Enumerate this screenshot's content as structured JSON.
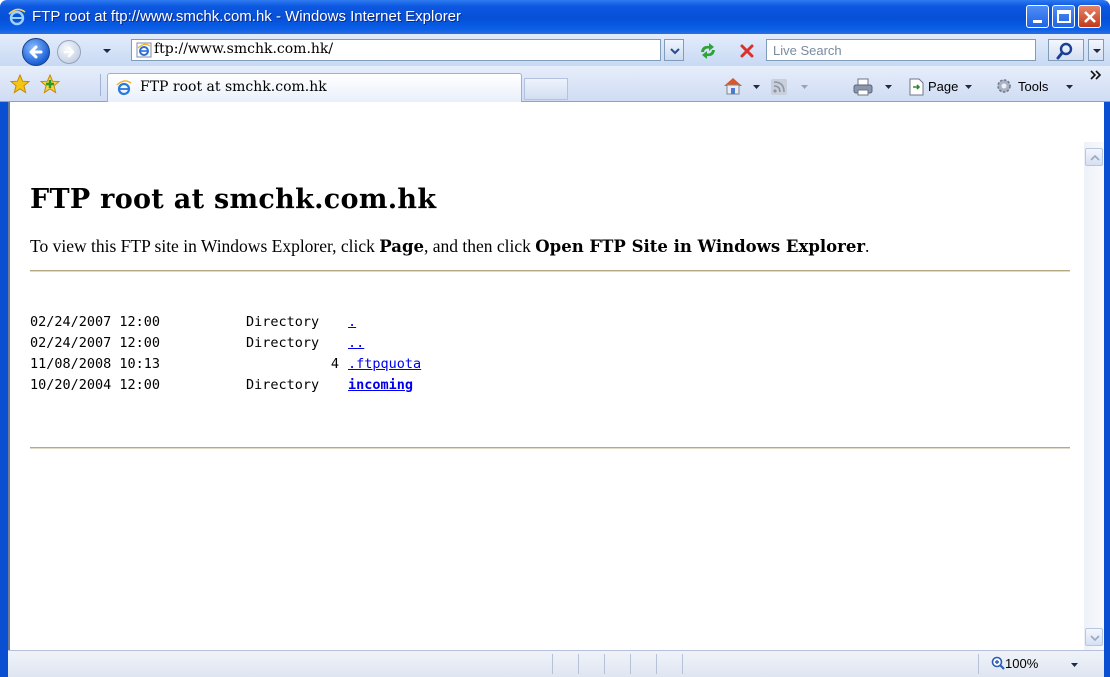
{
  "window": {
    "title": "FTP root at ftp://www.smchk.com.hk - Windows Internet Explorer"
  },
  "toolbar": {
    "address": "ftp://www.smchk.com.hk/",
    "search_placeholder": "Live Search"
  },
  "tabs": [
    {
      "label": "FTP root at smchk.com.hk",
      "icon": "ie-page-icon"
    }
  ],
  "command_bar": {
    "page_label": "Page",
    "tools_label": "Tools"
  },
  "page": {
    "heading": "FTP root at smchk.com.hk",
    "instruction_prefix": "To view this FTP site in Windows Explorer, click ",
    "instruction_page": "Page",
    "instruction_middle": ", and then click ",
    "instruction_open": "Open FTP Site in Windows Explorer",
    "instruction_suffix": "."
  },
  "listing": [
    {
      "date": "02/24/2007 12:00",
      "type": "Directory",
      "name": "."
    },
    {
      "date": "02/24/2007 12:00",
      "type": "Directory",
      "name": ".."
    },
    {
      "date": "11/08/2008 10:13",
      "type": "4",
      "name": ".ftpquota"
    },
    {
      "date": "10/20/2004 12:00",
      "type": "Directory",
      "name": "incoming"
    }
  ],
  "status_bar": {
    "zoom": "100%"
  },
  "colors": {
    "title_bar": "#0650d8",
    "link": "#0000ee",
    "rule": "#b5a984"
  }
}
